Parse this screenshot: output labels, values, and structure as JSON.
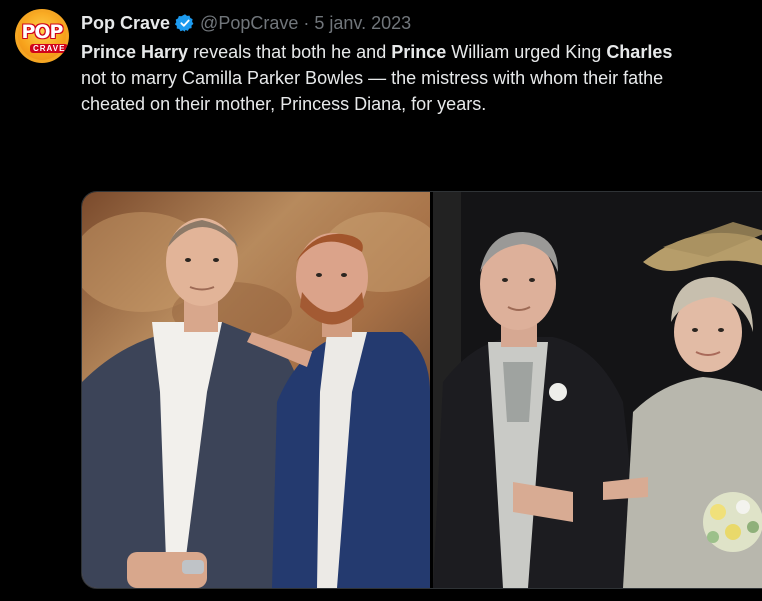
{
  "account": {
    "display_name": "Pop Crave",
    "handle": "@PopCrave",
    "separator": "·",
    "date": "5 janv. 2023",
    "avatar_text_top": "POP",
    "avatar_text_bottom": "CRAVE"
  },
  "tweet": {
    "line1": [
      {
        "text": "Prince Harry",
        "bold": true
      },
      {
        "text": " reveals that both he and ",
        "bold": false
      },
      {
        "text": "Prince",
        "bold": true
      },
      {
        "text": " William urged King ",
        "bold": false
      },
      {
        "text": "Charles",
        "bold": true
      }
    ],
    "line2": "not to marry Camilla Parker Bowles — the mistress with whom their fathe",
    "line3": "cheated on their mother, Princess Diana, for years."
  },
  "colors": {
    "background": "#000000",
    "text": "#e7e9ea",
    "muted": "#71767b",
    "verified": "#1d9bf0",
    "brand_orange": "#f5a623",
    "brand_red": "#d0021b"
  },
  "media": {
    "images": [
      {
        "icon": "photo-brothers"
      },
      {
        "icon": "photo-wedding"
      }
    ]
  }
}
